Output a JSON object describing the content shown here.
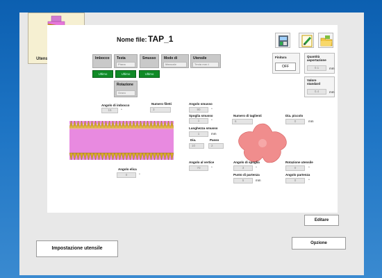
{
  "tool_preview": {
    "caption": "Utensile selezionato"
  },
  "header": {
    "file_label": "Nome file:",
    "file_name": "TAP_1"
  },
  "tabs": [
    {
      "label": "Imbocco"
    },
    {
      "label": "Testa",
      "value": "Piana"
    },
    {
      "label": "Smusso"
    },
    {
      "label": "Modo di",
      "value": "Manuale"
    },
    {
      "label": "Utensile",
      "value": "Testa mm t"
    }
  ],
  "green_buttons": [
    "Ultimo",
    "Ultimo",
    "Ultimo"
  ],
  "rotation": {
    "label": "Rotazione",
    "value": "Oraro"
  },
  "finitura": {
    "label": "Finitura",
    "button": "OFF"
  },
  "asportazione": {
    "label": "Quantità asportazione",
    "value": "0.1",
    "unit": "mm"
  },
  "valore_standard": {
    "label": "Valore standard",
    "value": "0.4",
    "unit": "mm"
  },
  "params": {
    "angolo_imbocco": {
      "label": "Angolo di imbocco",
      "value": "15",
      "unit": "°"
    },
    "numero_filetti": {
      "label": "Numero filetti",
      "value": "3"
    },
    "angolo_smusso": {
      "label": "Angolo smusso",
      "value": "90",
      "unit": "°"
    },
    "spoglia_smusso": {
      "label": "Spoglia smusso",
      "value": "1",
      "unit": "°"
    },
    "lunghezza_smusso": {
      "label": "Lunghezza smusso",
      "value": "1",
      "unit": "mm"
    },
    "dia": {
      "label": "Dia.",
      "value": "10"
    },
    "passo": {
      "label": "Passo",
      "value": "2"
    },
    "numero_taglienti": {
      "label": "Numero di taglienti",
      "value": "6"
    },
    "dia_piccolo": {
      "label": "Dia. piccolo",
      "value": "0",
      "unit": "mm"
    },
    "angolo_elica": {
      "label": "Angolo elica",
      "value": "0",
      "unit": "°"
    },
    "angolo_vertice": {
      "label": "Angolo al vertice",
      "value": "70",
      "unit": "°"
    },
    "angolo_spoglia": {
      "label": "Angolo di spoglia",
      "value": "3",
      "unit": "°"
    },
    "punto_partenza": {
      "label": "Punto di partenza",
      "value": "5",
      "unit": "mm"
    },
    "rotazione_utensile": {
      "label": "Rotazione utensile",
      "value": "0",
      "unit": "°"
    },
    "angolo_partenza": {
      "label": "Angolo partenza",
      "value": "0",
      "unit": "°"
    }
  },
  "buttons": {
    "editare": "Editare",
    "impostazione": "Impostazione utensile",
    "opzione": "Opzione"
  },
  "colors": {
    "background_blue": "#1d74c4",
    "green_button": "#108a26",
    "tool_pink": "#e676d9",
    "tool_gold": "#d8aa28",
    "cutter_red": "#f08d8d"
  }
}
